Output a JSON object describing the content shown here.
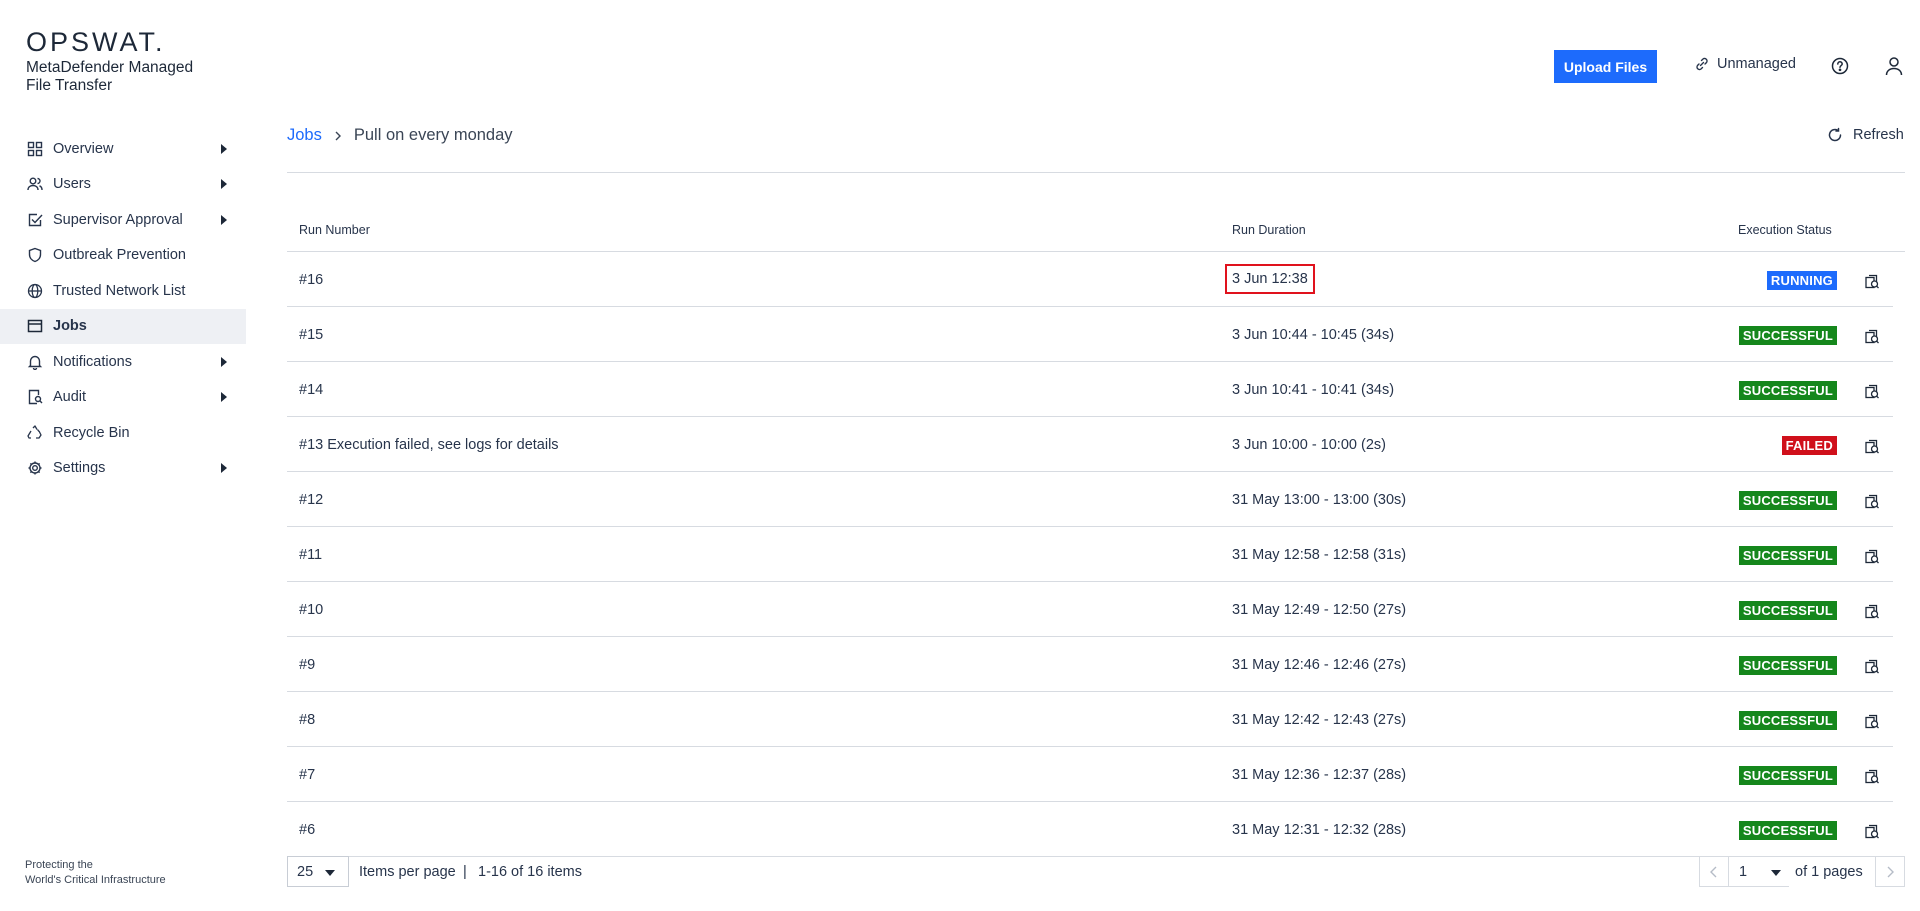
{
  "brand": {
    "logo": "OPSWAT.",
    "product": "MetaDefender Managed File Transfer"
  },
  "sidebar": {
    "items": [
      {
        "label": "Overview",
        "icon": "grid-icon",
        "has_submenu": true
      },
      {
        "label": "Users",
        "icon": "users-icon",
        "has_submenu": true
      },
      {
        "label": "Supervisor Approval",
        "icon": "checkbox-icon",
        "has_submenu": true
      },
      {
        "label": "Outbreak Prevention",
        "icon": "shield-icon",
        "has_submenu": false
      },
      {
        "label": "Trusted Network List",
        "icon": "globe-icon",
        "has_submenu": false
      },
      {
        "label": "Jobs",
        "icon": "jobs-icon",
        "has_submenu": false,
        "active": true
      },
      {
        "label": "Notifications",
        "icon": "bell-icon",
        "has_submenu": true
      },
      {
        "label": "Audit",
        "icon": "audit-icon",
        "has_submenu": true
      },
      {
        "label": "Recycle Bin",
        "icon": "recycle-icon",
        "has_submenu": false
      },
      {
        "label": "Settings",
        "icon": "gear-icon",
        "has_submenu": true
      }
    ],
    "footer_line1": "Protecting the",
    "footer_line2": "World's Critical Infrastructure"
  },
  "header": {
    "upload_label": "Upload Files",
    "unmanaged_label": "Unmanaged"
  },
  "breadcrumb": {
    "root": "Jobs",
    "current": "Pull on every monday"
  },
  "refresh_label": "Refresh",
  "table": {
    "columns": {
      "run": "Run Number",
      "duration": "Run Duration",
      "status": "Execution Status"
    },
    "rows": [
      {
        "run": "#16",
        "duration": "3 Jun 12:38",
        "status": "RUNNING"
      },
      {
        "run": "#15",
        "duration": "3 Jun 10:44 - 10:45 (34s)",
        "status": "SUCCESSFUL"
      },
      {
        "run": "#14",
        "duration": "3 Jun 10:41 - 10:41 (34s)",
        "status": "SUCCESSFUL"
      },
      {
        "run": "#13 Execution failed, see logs for details",
        "duration": "3 Jun 10:00 - 10:00 (2s)",
        "status": "FAILED"
      },
      {
        "run": "#12",
        "duration": "31 May 13:00 - 13:00 (30s)",
        "status": "SUCCESSFUL"
      },
      {
        "run": "#11",
        "duration": "31 May 12:58 - 12:58 (31s)",
        "status": "SUCCESSFUL"
      },
      {
        "run": "#10",
        "duration": "31 May 12:49 - 12:50 (27s)",
        "status": "SUCCESSFUL"
      },
      {
        "run": "#9",
        "duration": "31 May 12:46 - 12:46 (27s)",
        "status": "SUCCESSFUL"
      },
      {
        "run": "#8",
        "duration": "31 May 12:42 - 12:43 (27s)",
        "status": "SUCCESSFUL"
      },
      {
        "run": "#7",
        "duration": "31 May 12:36 - 12:37 (28s)",
        "status": "SUCCESSFUL"
      },
      {
        "run": "#6",
        "duration": "31 May 12:31 - 12:32 (28s)",
        "status": "SUCCESSFUL"
      }
    ]
  },
  "pagination": {
    "page_size": "25",
    "items_per_page_label": "Items per page",
    "separator": "|",
    "range": "1-16 of 16 items",
    "page": "1",
    "of_pages": "of 1 pages"
  },
  "colors": {
    "accent": "#1d6bfc",
    "success": "#15871c",
    "failed": "#d0101b",
    "highlight": "#e0121d"
  }
}
